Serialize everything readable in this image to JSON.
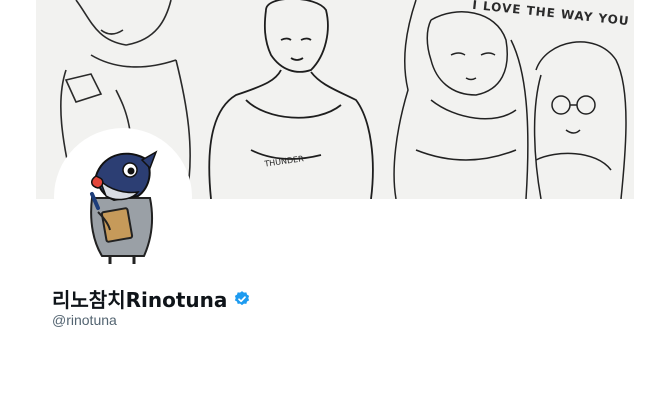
{
  "profile": {
    "display_name": "리노참치Rinotuna",
    "handle": "@rinotuna",
    "verified_icon": "verified-badge-icon"
  },
  "banner": {
    "handwritten_text": "I LOVE THE WAY YOU"
  },
  "colors": {
    "verified": "#1d9bf0",
    "handle": "#536471",
    "name": "#0f1419"
  }
}
